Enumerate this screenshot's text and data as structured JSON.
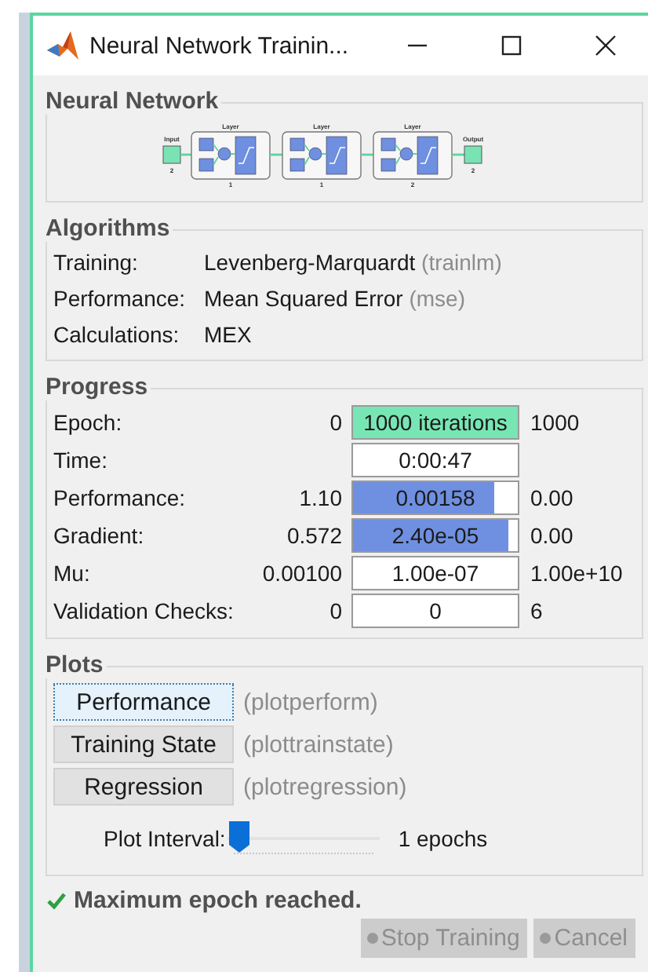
{
  "window": {
    "title": "Neural Network Trainin..."
  },
  "neural_network": {
    "heading": "Neural Network",
    "input": {
      "label": "Input",
      "size": "2"
    },
    "layers": [
      {
        "label": "Layer",
        "size": "1"
      },
      {
        "label": "Layer",
        "size": "1"
      },
      {
        "label": "Layer",
        "size": "2"
      }
    ],
    "output": {
      "label": "Output",
      "size": "2"
    }
  },
  "algorithms": {
    "heading": "Algorithms",
    "rows": [
      {
        "label": "Training:",
        "value": "Levenberg-Marquardt",
        "function": "(trainlm)"
      },
      {
        "label": "Performance:",
        "value": "Mean Squared Error",
        "function": "(mse)"
      },
      {
        "label": "Calculations:",
        "value": "MEX"
      }
    ]
  },
  "progress": {
    "heading": "Progress",
    "rows": [
      {
        "label": "Epoch:",
        "min": "0",
        "reading": "1000 iterations",
        "max": "1000",
        "level": 1,
        "color": "#78e6b4"
      },
      {
        "label": "Time:",
        "reading": "0:00:47"
      },
      {
        "label": "Performance:",
        "min": "1.10",
        "reading": "0.00158",
        "max": "0.00",
        "level": 0.86,
        "color": "#6f8fe0"
      },
      {
        "label": "Gradient:",
        "min": "0.572",
        "reading": "2.40e-05",
        "max": "0.00",
        "level": 0.94,
        "color": "#6f8fe0"
      },
      {
        "label": "Mu:",
        "min": "0.00100",
        "reading": "1.00e-07",
        "max": "1.00e+10"
      },
      {
        "label": "Validation Checks:",
        "min": "0",
        "reading": "0",
        "max": "6"
      }
    ]
  },
  "plots": {
    "heading": "Plots",
    "buttons": [
      {
        "label": "Performance",
        "function": "(plotperform)",
        "selected": true
      },
      {
        "label": "Training State",
        "function": "(plottrainstate)",
        "selected": false
      },
      {
        "label": "Regression",
        "function": "(plotregression)",
        "selected": false
      }
    ],
    "plot_interval": {
      "label": "Plot Interval:",
      "level": 0,
      "reading": "1 epochs"
    }
  },
  "status": {
    "message": "Maximum epoch reached.",
    "ok": true
  },
  "buttons": [
    {
      "label": "Stop Training",
      "disabled": true
    },
    {
      "label": "Cancel",
      "disabled": true
    }
  ]
}
